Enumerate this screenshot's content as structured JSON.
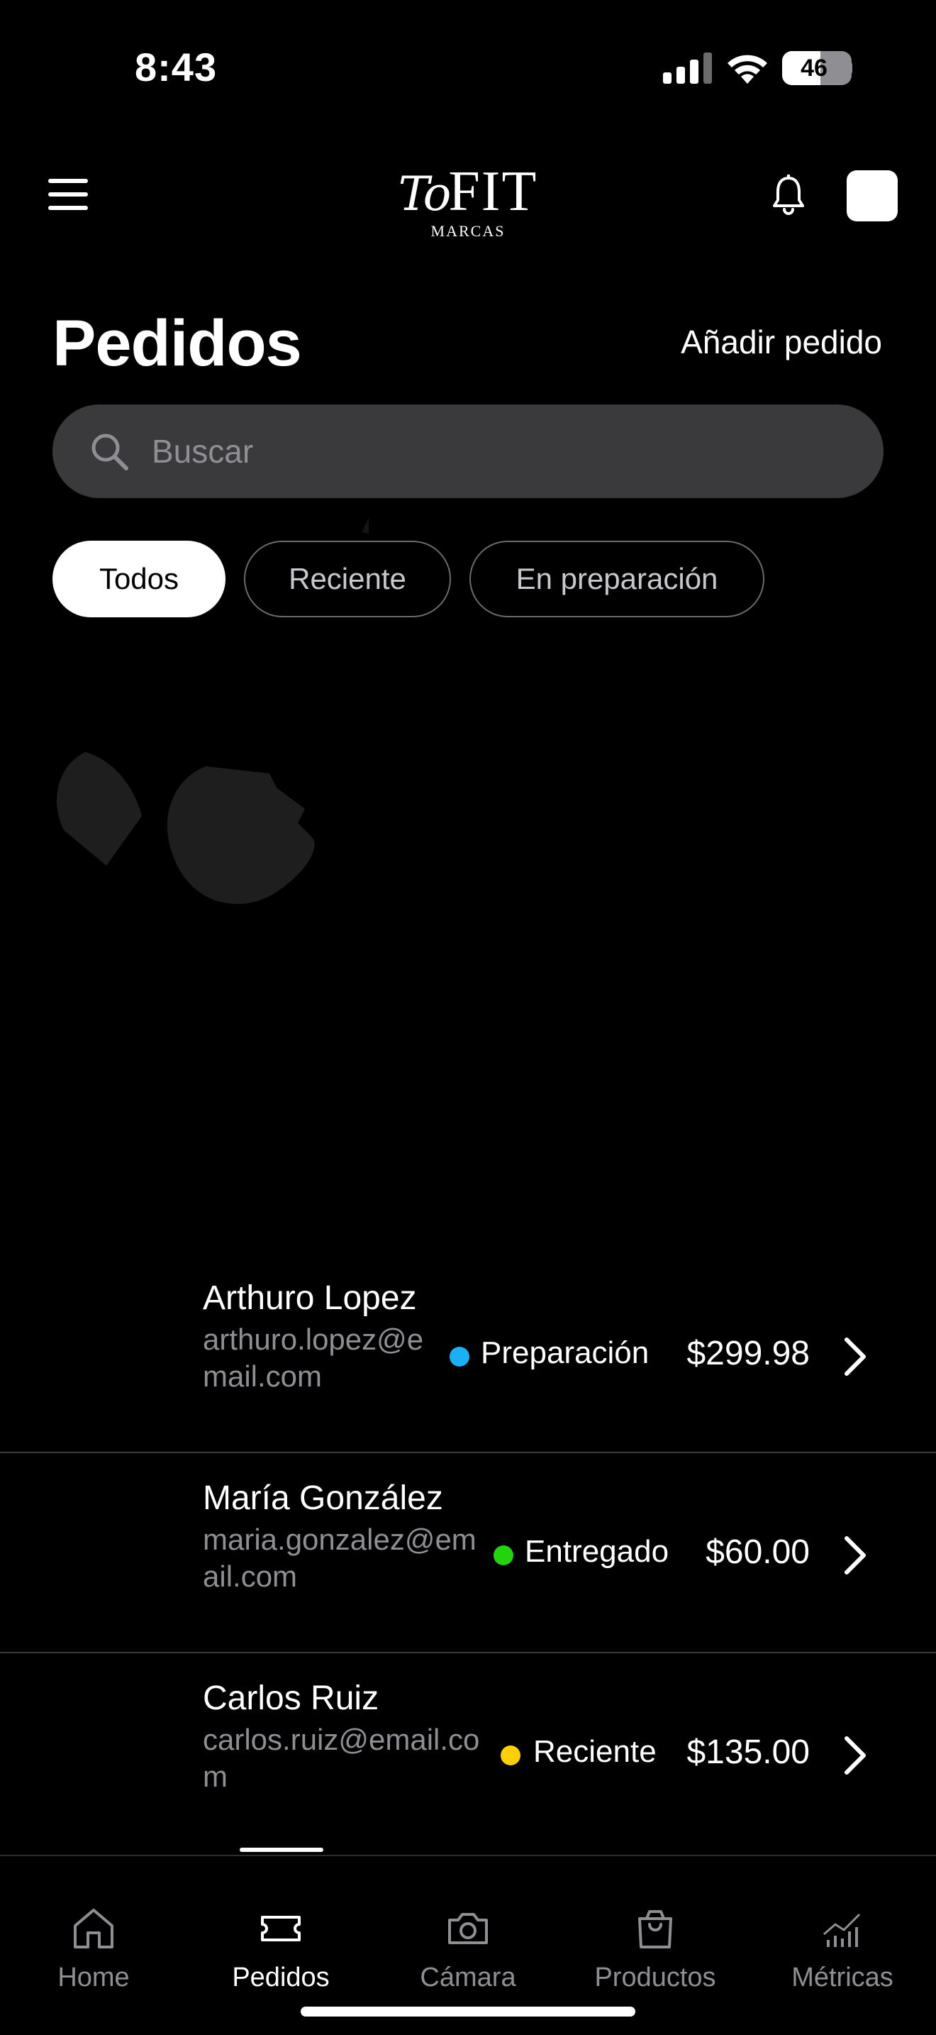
{
  "status_bar": {
    "time": "8:43",
    "battery": "46"
  },
  "header": {
    "logo_script": "To",
    "logo_main": "FIT",
    "logo_sub": "MARCAS"
  },
  "page": {
    "title": "Pedidos",
    "add_label": "Añadir pedido"
  },
  "search": {
    "placeholder": "Buscar"
  },
  "filters": [
    {
      "label": "Todos",
      "active": true
    },
    {
      "label": "Reciente",
      "active": false
    },
    {
      "label": "En preparación",
      "active": false
    }
  ],
  "orders": [
    {
      "name": "Arthuro Lopez",
      "email_line1": "arthuro.lopez@e",
      "email_line2": "mail.com",
      "status": "Preparación",
      "status_color": "#1ab0f5",
      "price": "$299.98"
    },
    {
      "name": "María González",
      "email_line1": "maria.gonzalez@em",
      "email_line2": "ail.com",
      "status": "Entregado",
      "status_color": "#22d40c",
      "price": "$60.00"
    },
    {
      "name": "Carlos Ruiz",
      "email_line1": "carlos.ruiz@email.co",
      "email_line2": "m",
      "status": "Reciente",
      "status_color": "#ffd000",
      "price": "$135.00"
    }
  ],
  "tabs": [
    {
      "label": "Home",
      "icon": "house-icon",
      "active": false
    },
    {
      "label": "Pedidos",
      "icon": "ticket-icon",
      "active": true
    },
    {
      "label": "Cámara",
      "icon": "camera-icon",
      "active": false
    },
    {
      "label": "Productos",
      "icon": "shopping-bag-icon",
      "active": false
    },
    {
      "label": "Métricas",
      "icon": "chart-icon",
      "active": false
    }
  ]
}
